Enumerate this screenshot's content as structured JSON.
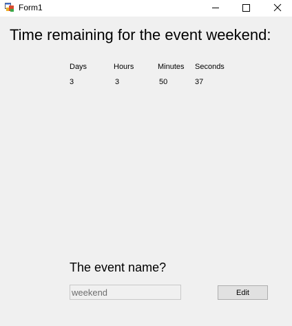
{
  "window": {
    "title": "Form1",
    "icon": "form-app-icon",
    "controls": [
      "minimize-icon",
      "maximize-icon",
      "close-icon"
    ]
  },
  "main": {
    "heading": "Time remaining for the event weekend:",
    "columns": [
      {
        "label": "Days",
        "value": "3"
      },
      {
        "label": "Hours",
        "value": "3"
      },
      {
        "label": "Minutes",
        "value": "50"
      },
      {
        "label": "Seconds",
        "value": "37"
      }
    ]
  },
  "event": {
    "question": "The event name?",
    "name_value": "weekend",
    "edit_label": "Edit"
  },
  "colors": {
    "background": "#f0f0f0",
    "titlebar": "#ffffff",
    "button_face": "#e1e1e1"
  }
}
